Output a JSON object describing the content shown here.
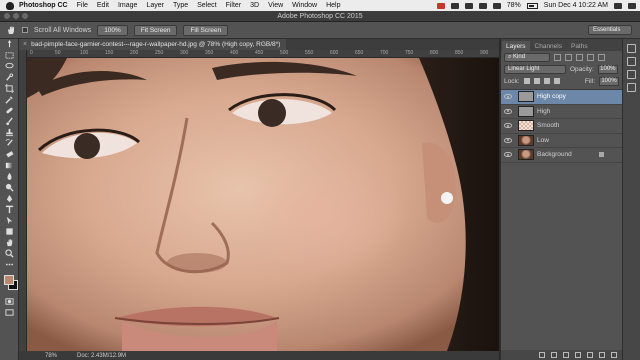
{
  "menubar": {
    "app": "Photoshop CC",
    "items": [
      "File",
      "Edit",
      "Image",
      "Layer",
      "Type",
      "Select",
      "Filter",
      "3D",
      "View",
      "Window",
      "Help"
    ],
    "battery": "78%",
    "clock": "Sun Dec 4  10:22 AM"
  },
  "window": {
    "title": "Adobe Photoshop CC 2015"
  },
  "options": {
    "scroll_all": "Scroll All Windows",
    "zoom_btn": "100%",
    "fit_btn": "Fit Screen",
    "fill_btn": "Fill Screen",
    "workspace": "Essentials"
  },
  "document": {
    "tab_title": "bad-pimple-face-garnier-contest---rage-r-wallpaper-hd.jpg @ 78% (High copy, RGB/8*)",
    "ruler_marks": [
      "0",
      "50",
      "100",
      "150",
      "200",
      "250",
      "300",
      "350",
      "400",
      "450",
      "500",
      "550",
      "600",
      "650",
      "700",
      "750",
      "800",
      "850",
      "900"
    ],
    "zoom": "78%",
    "doc_size": "Doc: 2.43M/12.9M"
  },
  "tools": [
    "move",
    "marquee",
    "lasso",
    "quick-select",
    "crop",
    "eyedropper",
    "healing",
    "brush",
    "stamp",
    "history-brush",
    "eraser",
    "gradient",
    "blur",
    "dodge",
    "pen",
    "type",
    "path-select",
    "shape",
    "hand",
    "zoom"
  ],
  "colors": {
    "foreground": "#b98870",
    "background": "#111111",
    "selection": "#6c87a8"
  },
  "panels": {
    "tabs": [
      "Layers",
      "Channels",
      "Paths"
    ],
    "filter": "Kind",
    "blend_mode": "Linear Light",
    "opacity_label": "Opacity:",
    "opacity": "100%",
    "lock_label": "Lock:",
    "fill_label": "Fill:",
    "fill": "100%",
    "layers": [
      {
        "name": "High copy",
        "thumb": "gray",
        "selected": true,
        "locked": false
      },
      {
        "name": "High",
        "thumb": "gray",
        "selected": false,
        "locked": false
      },
      {
        "name": "Smooth",
        "thumb": "checker",
        "selected": false,
        "locked": false
      },
      {
        "name": "Low",
        "thumb": "face",
        "selected": false,
        "locked": false
      },
      {
        "name": "Background",
        "thumb": "face",
        "selected": false,
        "locked": true
      }
    ]
  }
}
